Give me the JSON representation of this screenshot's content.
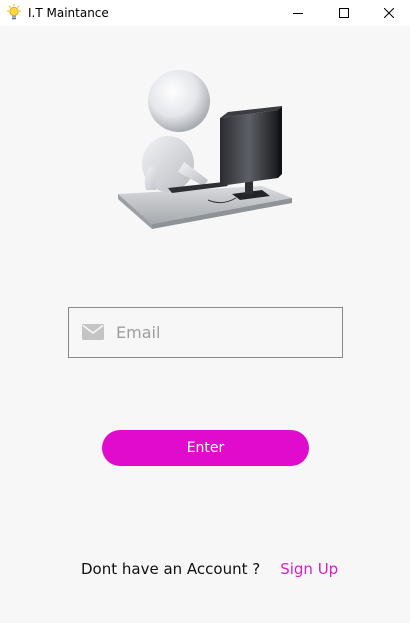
{
  "window": {
    "title": "I.T Maintance",
    "icon": "lightbulb-icon",
    "controls": [
      "minimize-icon",
      "maximize-icon",
      "close-icon"
    ]
  },
  "illustration": {
    "subject": "figure-at-computer-illustration"
  },
  "email": {
    "placeholder": "Email",
    "value": "",
    "icon": "mail-icon"
  },
  "enter_button": {
    "label": "Enter"
  },
  "signup": {
    "prompt": "Dont have an Account ?",
    "link": "Sign Up"
  },
  "colors": {
    "accent": "#e10bce",
    "link": "#d61fc4",
    "background": "#f7f7f7"
  }
}
